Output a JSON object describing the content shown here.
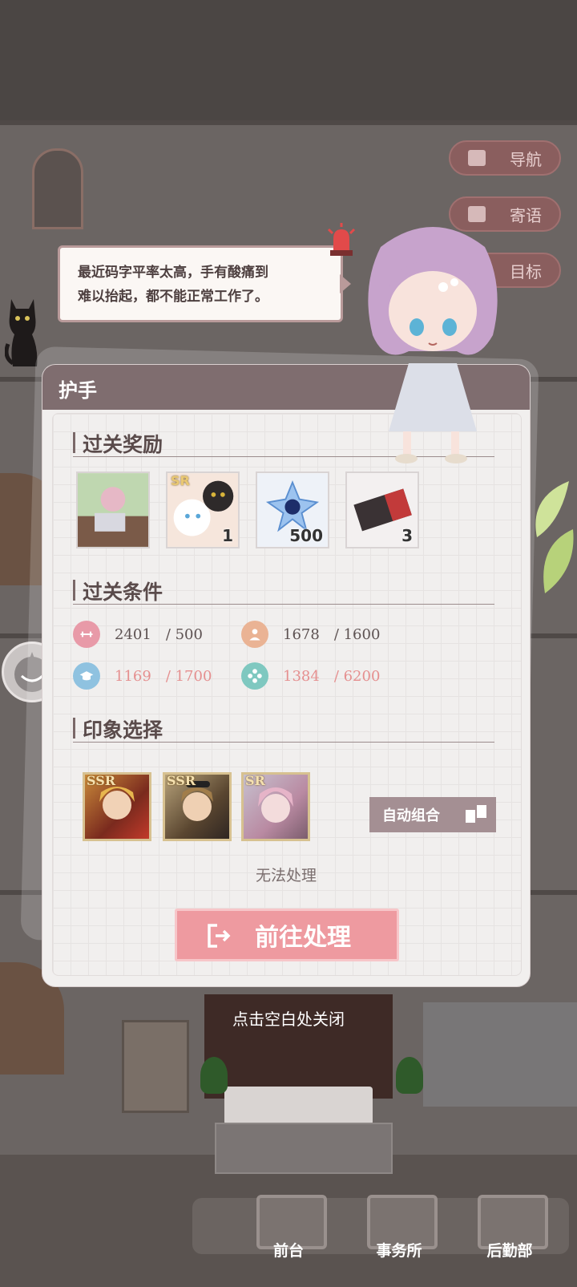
{
  "top_buttons": {
    "nav_label": "导航",
    "message_label": "寄语",
    "goal_label": "目标"
  },
  "speech": {
    "line1": "最近码字平率太高，手有酸痛到",
    "line2": "难以抬起，都不能正常工作了。"
  },
  "panel": {
    "title": "护手",
    "rewards_title": "过关奖励",
    "rewards": [
      {
        "name": "story-card",
        "count": "",
        "badge": ""
      },
      {
        "name": "sr-cat-card",
        "count": "1",
        "badge": "SR"
      },
      {
        "name": "crystal-flower",
        "count": "500",
        "badge": ""
      },
      {
        "name": "ticket",
        "count": "3",
        "badge": ""
      }
    ],
    "conditions_title": "过关条件",
    "conditions": [
      {
        "current": "2401",
        "target": "/ 500",
        "icon": "strength-icon",
        "color": "#e89aa8",
        "met": true
      },
      {
        "current": "1678",
        "target": "/ 1600",
        "icon": "person-icon",
        "color": "#eab394",
        "met": true
      },
      {
        "current": "1169",
        "target": "/ 1700",
        "icon": "graduation-icon",
        "color": "#8fc2e0",
        "met": false
      },
      {
        "current": "1384",
        "target": "/ 6200",
        "icon": "flower-icon",
        "color": "#7fc8c0",
        "met": false
      }
    ],
    "impressions_title": "印象选择",
    "impressions": [
      {
        "badge": "SSR"
      },
      {
        "badge": "SSR"
      },
      {
        "badge": "SR"
      }
    ],
    "auto_combine_label": "自动组合",
    "status_text": "无法处理",
    "go_button_label": "前往处理"
  },
  "close_hint": "点击空白处关闭",
  "bottom_nav": [
    {
      "label": "前台"
    },
    {
      "label": "事务所"
    },
    {
      "label": "后勤部"
    }
  ],
  "colors": {
    "panel_header": "#7f6d6f",
    "go_button": "#ee9aa0",
    "unmet_text": "#e58f8f"
  }
}
